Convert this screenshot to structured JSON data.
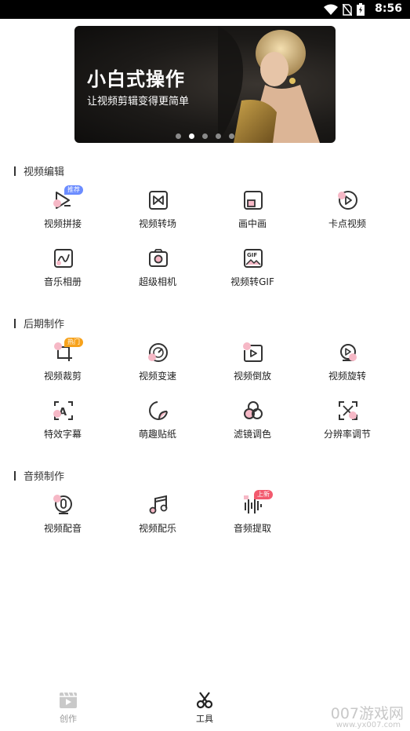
{
  "status_bar": {
    "time": "8:56",
    "icons": [
      "wifi-icon",
      "no-sim-icon",
      "battery-icon"
    ]
  },
  "banner": {
    "title": "小白式操作",
    "subtitle": "让视频剪辑变得更简单",
    "page_count": 5,
    "active_page": 2
  },
  "sections": [
    {
      "title": "视频编辑",
      "tools": [
        {
          "label": "视频拼接",
          "icon": "video-splice-icon",
          "badge": "推荐"
        },
        {
          "label": "视频转场",
          "icon": "video-transition-icon"
        },
        {
          "label": "画中画",
          "icon": "picture-in-picture-icon"
        },
        {
          "label": "卡点视频",
          "icon": "beat-video-icon"
        },
        {
          "label": "音乐相册",
          "icon": "music-album-icon"
        },
        {
          "label": "超级相机",
          "icon": "super-camera-icon"
        },
        {
          "label": "视频转GIF",
          "icon": "video-to-gif-icon"
        }
      ]
    },
    {
      "title": "后期制作",
      "tools": [
        {
          "label": "视频裁剪",
          "icon": "video-crop-icon",
          "badge": "热门"
        },
        {
          "label": "视频变速",
          "icon": "video-speed-icon"
        },
        {
          "label": "视频倒放",
          "icon": "video-reverse-icon"
        },
        {
          "label": "视频旋转",
          "icon": "video-rotate-icon"
        },
        {
          "label": "特效字幕",
          "icon": "effect-subtitle-icon"
        },
        {
          "label": "萌趣贴纸",
          "icon": "sticker-icon"
        },
        {
          "label": "滤镜调色",
          "icon": "filter-icon"
        },
        {
          "label": "分辨率调节",
          "icon": "resolution-icon"
        }
      ]
    },
    {
      "title": "音频制作",
      "tools": [
        {
          "label": "视频配音",
          "icon": "dubbing-icon"
        },
        {
          "label": "视频配乐",
          "icon": "background-music-icon"
        },
        {
          "label": "音频提取",
          "icon": "audio-extract-icon",
          "badge": "上新"
        }
      ]
    }
  ],
  "tabbar": {
    "tabs": [
      {
        "label": "创作",
        "icon": "create-icon",
        "active": false
      },
      {
        "label": "工具",
        "icon": "scissors-icon",
        "active": true
      }
    ]
  },
  "watermark": {
    "text": "007游戏网",
    "subtext": "www.yx007.com"
  },
  "colors": {
    "accent_pink": "#f6b8c6",
    "badge_blue": "#6b8cff",
    "badge_orange": "#f7a21b",
    "badge_red": "#f25a6e"
  }
}
